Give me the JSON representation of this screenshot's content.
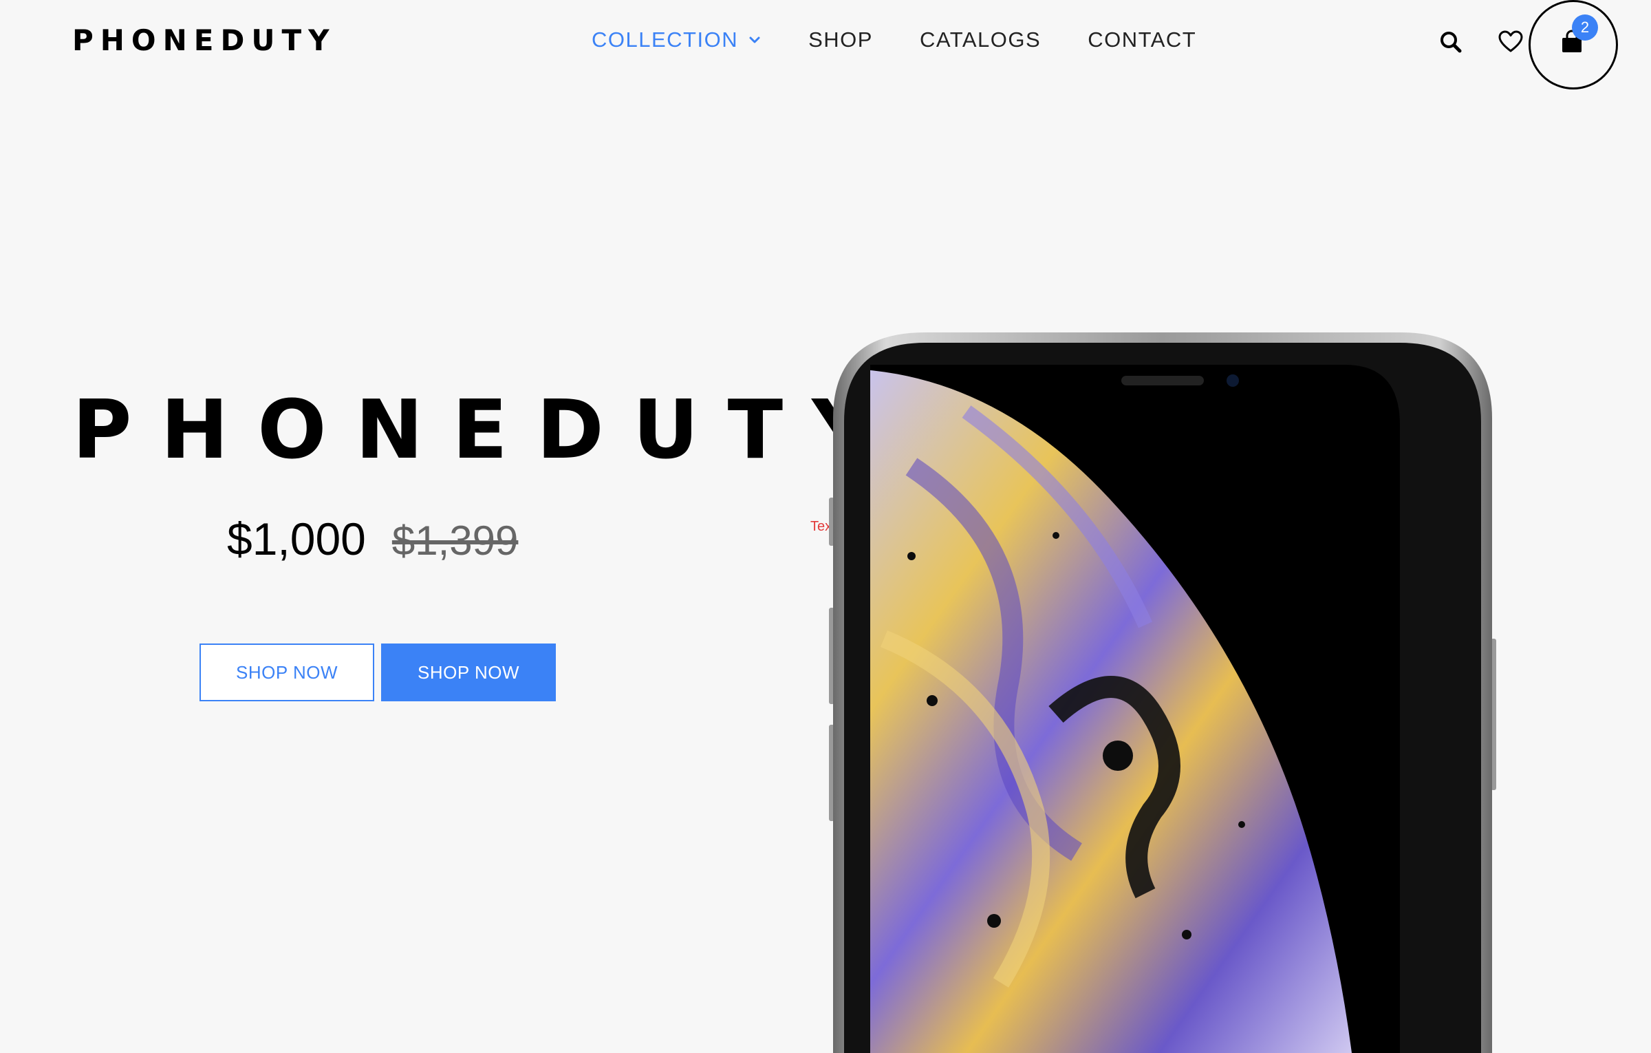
{
  "header": {
    "logo": "PHONEDUTY",
    "nav": [
      {
        "label": "COLLECTION",
        "active": true,
        "has_dropdown": true
      },
      {
        "label": "SHOP",
        "active": false
      },
      {
        "label": "CATALOGS",
        "active": false
      },
      {
        "label": "CONTACT",
        "active": false
      }
    ],
    "icons": [
      "search-icon",
      "heart-icon",
      "shopping-bag-icon"
    ],
    "cart_count": "2"
  },
  "hero": {
    "title": "PHONEDUTY",
    "price_new": "$1,000",
    "price_old": "$1,399",
    "button_outline": "SHOP NOW",
    "button_solid": "SHOP NOW",
    "stray_label": "Text"
  },
  "colors": {
    "accent": "#3b82f6",
    "background": "#f7f7f7",
    "text": "#000000"
  }
}
